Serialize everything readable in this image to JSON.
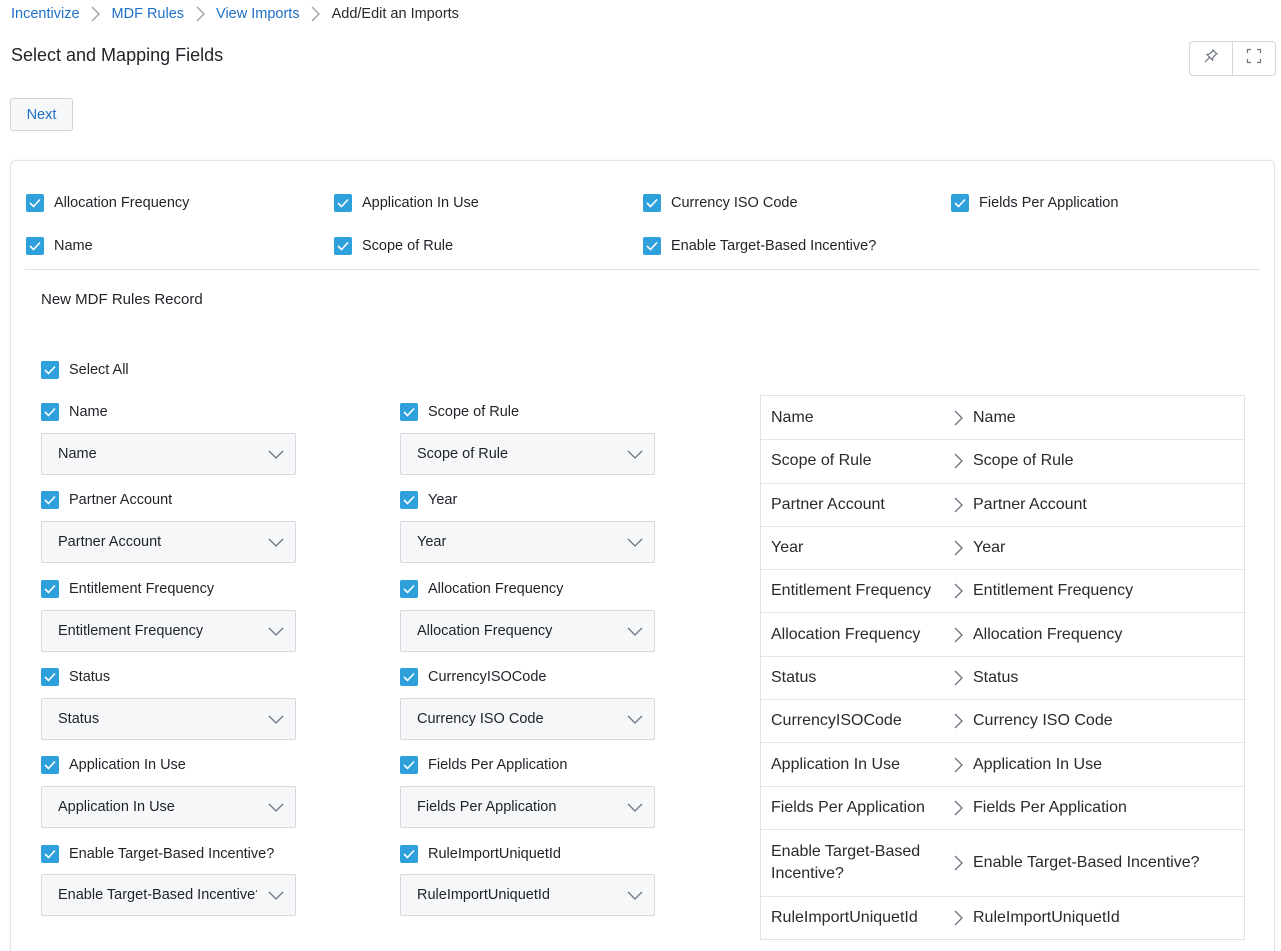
{
  "breadcrumb": {
    "items": [
      "Incentivize",
      "MDF Rules",
      "View Imports"
    ],
    "current": "Add/Edit an Imports"
  },
  "page_title": "Select and Mapping Fields",
  "top_actions": {
    "pin_icon": "pin-icon",
    "expand_icon": "expand-icon"
  },
  "next_label": "Next",
  "colors": {
    "accent": "#2ea0dc",
    "link": "#1f6fc5"
  },
  "top_fields": [
    "Allocation Frequency",
    "Application In Use",
    "Currency ISO Code",
    "Fields Per Application",
    "Name",
    "Scope of Rule",
    "Enable Target-Based Incentive?"
  ],
  "record_title": "New MDF Rules Record",
  "select_all_label": "Select All",
  "fields": [
    {
      "label": "Name",
      "value": "Name"
    },
    {
      "label": "Scope of Rule",
      "value": "Scope of Rule"
    },
    {
      "label": "Partner Account",
      "value": "Partner Account"
    },
    {
      "label": "Year",
      "value": "Year"
    },
    {
      "label": "Entitlement Frequency",
      "value": "Entitlement Frequency"
    },
    {
      "label": "Allocation Frequency",
      "value": "Allocation Frequency"
    },
    {
      "label": "Status",
      "value": "Status"
    },
    {
      "label": "CurrencyISOCode",
      "value": "Currency ISO Code"
    },
    {
      "label": "Application In Use",
      "value": "Application In Use"
    },
    {
      "label": "Fields Per Application",
      "value": "Fields Per Application"
    },
    {
      "label": "Enable Target-Based Incentive?",
      "value": "Enable Target-Based Incentive?"
    },
    {
      "label": "RuleImportUniquetId",
      "value": "RuleImportUniquetId"
    }
  ],
  "mapping": [
    {
      "source": "Name",
      "target": "Name"
    },
    {
      "source": "Scope of Rule",
      "target": "Scope of Rule"
    },
    {
      "source": "Partner Account",
      "target": "Partner Account"
    },
    {
      "source": "Year",
      "target": "Year"
    },
    {
      "source": "Entitlement Frequency",
      "target": "Entitlement Frequency"
    },
    {
      "source": "Allocation Frequency",
      "target": "Allocation Frequency"
    },
    {
      "source": "Status",
      "target": "Status"
    },
    {
      "source": "CurrencyISOCode",
      "target": "Currency ISO Code"
    },
    {
      "source": "Application In Use",
      "target": "Application In Use"
    },
    {
      "source": "Fields Per Application",
      "target": "Fields Per Application"
    },
    {
      "source": "Enable Target-Based Incentive?",
      "target": "Enable Target-Based Incentive?"
    },
    {
      "source": "RuleImportUniquetId",
      "target": "RuleImportUniquetId"
    }
  ]
}
